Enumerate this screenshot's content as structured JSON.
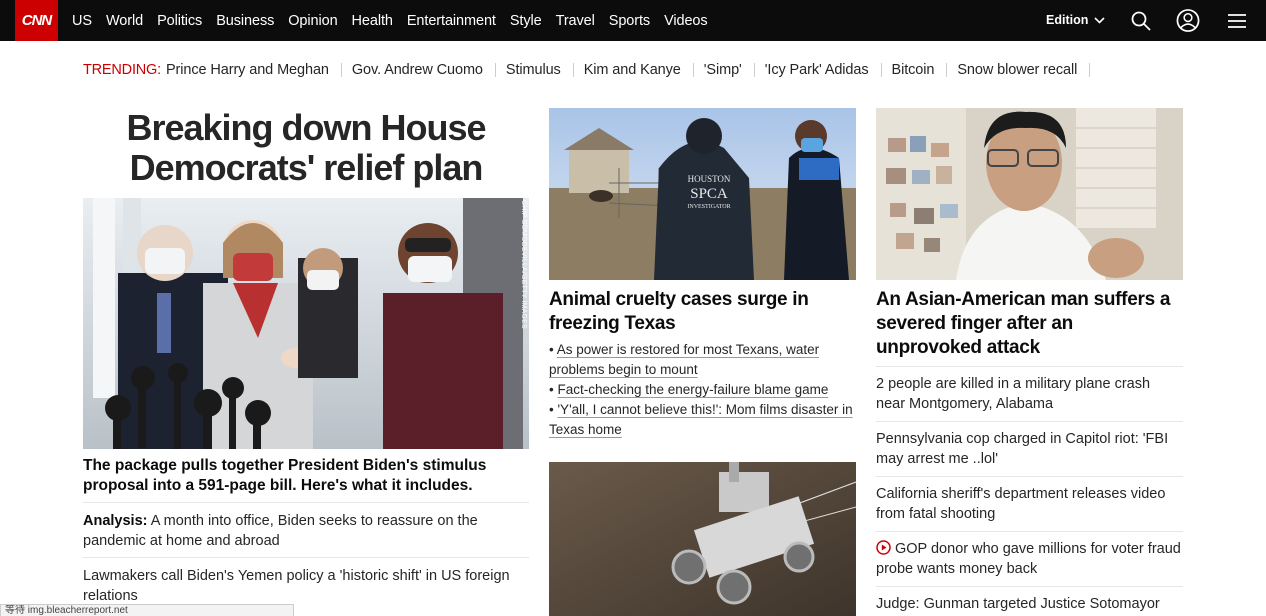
{
  "nav": {
    "logo": "CNN",
    "links": [
      "US",
      "World",
      "Politics",
      "Business",
      "Opinion",
      "Health",
      "Entertainment",
      "Style",
      "Travel",
      "Sports",
      "Videos"
    ],
    "edition": "Edition"
  },
  "trending": {
    "label": "TRENDING:",
    "items": [
      "Prince Harry and Meghan",
      "Gov. Andrew Cuomo",
      "Stimulus",
      "Kim and Kanye",
      "'Simp'",
      "'Icy Park' Adidas",
      "Bitcoin",
      "Snow blower recall"
    ]
  },
  "left": {
    "headline": "Breaking down House Democrats' relief plan",
    "image_credit": "CHIP SOMODEVILLA/GETTY IMAGES",
    "caption": "The package pulls together President Biden's stimulus proposal into a 591-page bill. Here's what it includes.",
    "items": [
      {
        "prefix": "Analysis:",
        "text": " A month into office, Biden seeks to reassure on the pandemic at home and abroad"
      },
      {
        "prefix": "",
        "text": "Lawmakers call Biden's Yemen policy a 'historic shift' in US foreign relations"
      }
    ]
  },
  "middle": {
    "headline": "Animal cruelty cases surge in freezing Texas",
    "jacket_text": "HOUSTON SPCA INVESTIGATOR",
    "bullets": [
      "As power is restored for most Texans, water problems begin to mount",
      "Fact-checking the energy-failure blame game",
      "'Y'all, I cannot believe this!': Mom films disaster in Texas home"
    ]
  },
  "right": {
    "headline": "An Asian-American man suffers a severed finger after an unprovoked attack",
    "items": [
      {
        "video": false,
        "text": "2 people are killed in a military plane crash near Montgomery, Alabama"
      },
      {
        "video": false,
        "text": "Pennsylvania cop charged in Capitol riot: 'FBI may arrest me ..lol'"
      },
      {
        "video": false,
        "text": "California sheriff's department releases video from fatal shooting"
      },
      {
        "video": true,
        "text": "GOP donor who gave millions for voter fraud probe wants money back"
      },
      {
        "video": false,
        "text": "Judge: Gunman targeted Justice Sotomayor"
      }
    ]
  },
  "status_bar": "等待 img.bleacherreport.net",
  "colors": {
    "brand_red": "#cc0000",
    "nav_bg": "#0c0c0c"
  }
}
